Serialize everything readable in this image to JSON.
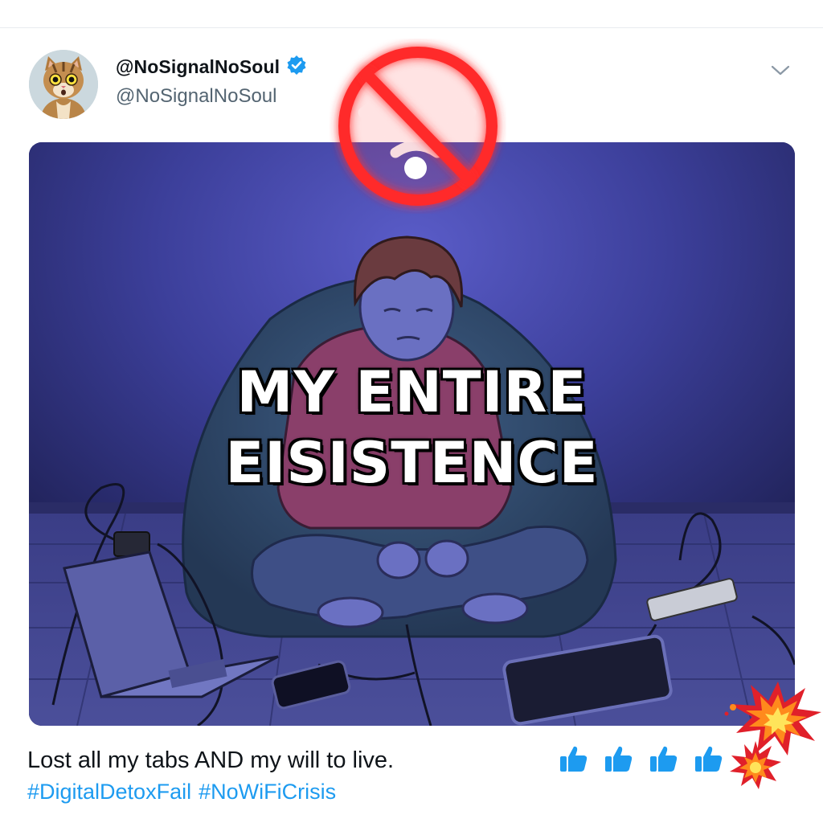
{
  "post": {
    "display_name": "@NoSignalNoSoul",
    "handle": "@NoSignalNoSoul",
    "verified": true,
    "avatar_icon": "cat-avatar-icon",
    "menu_icon": "chevron-down-icon"
  },
  "media": {
    "caption_line_1": "MY ENTIRE",
    "caption_line_2": "EISISTENCE",
    "overlay_icon": "no-wifi-icon"
  },
  "body": {
    "text": "Lost all my tabs AND my will to live.",
    "hashtags": [
      "#DigitalDetoxFail",
      "#NoWiFiCrisis"
    ]
  },
  "reactions": {
    "icons": [
      "thumbs-up-icon",
      "thumbs-up-icon",
      "thumbs-up-icon",
      "thumbs-up-icon"
    ],
    "decorations": [
      "explosion-icon",
      "explosion-icon"
    ]
  },
  "colors": {
    "link": "#1d9bf0",
    "verified": "#1d9bf0",
    "no_wifi_red": "#ff2a2a",
    "text": "#0f1419",
    "secondary_text": "#536471"
  }
}
